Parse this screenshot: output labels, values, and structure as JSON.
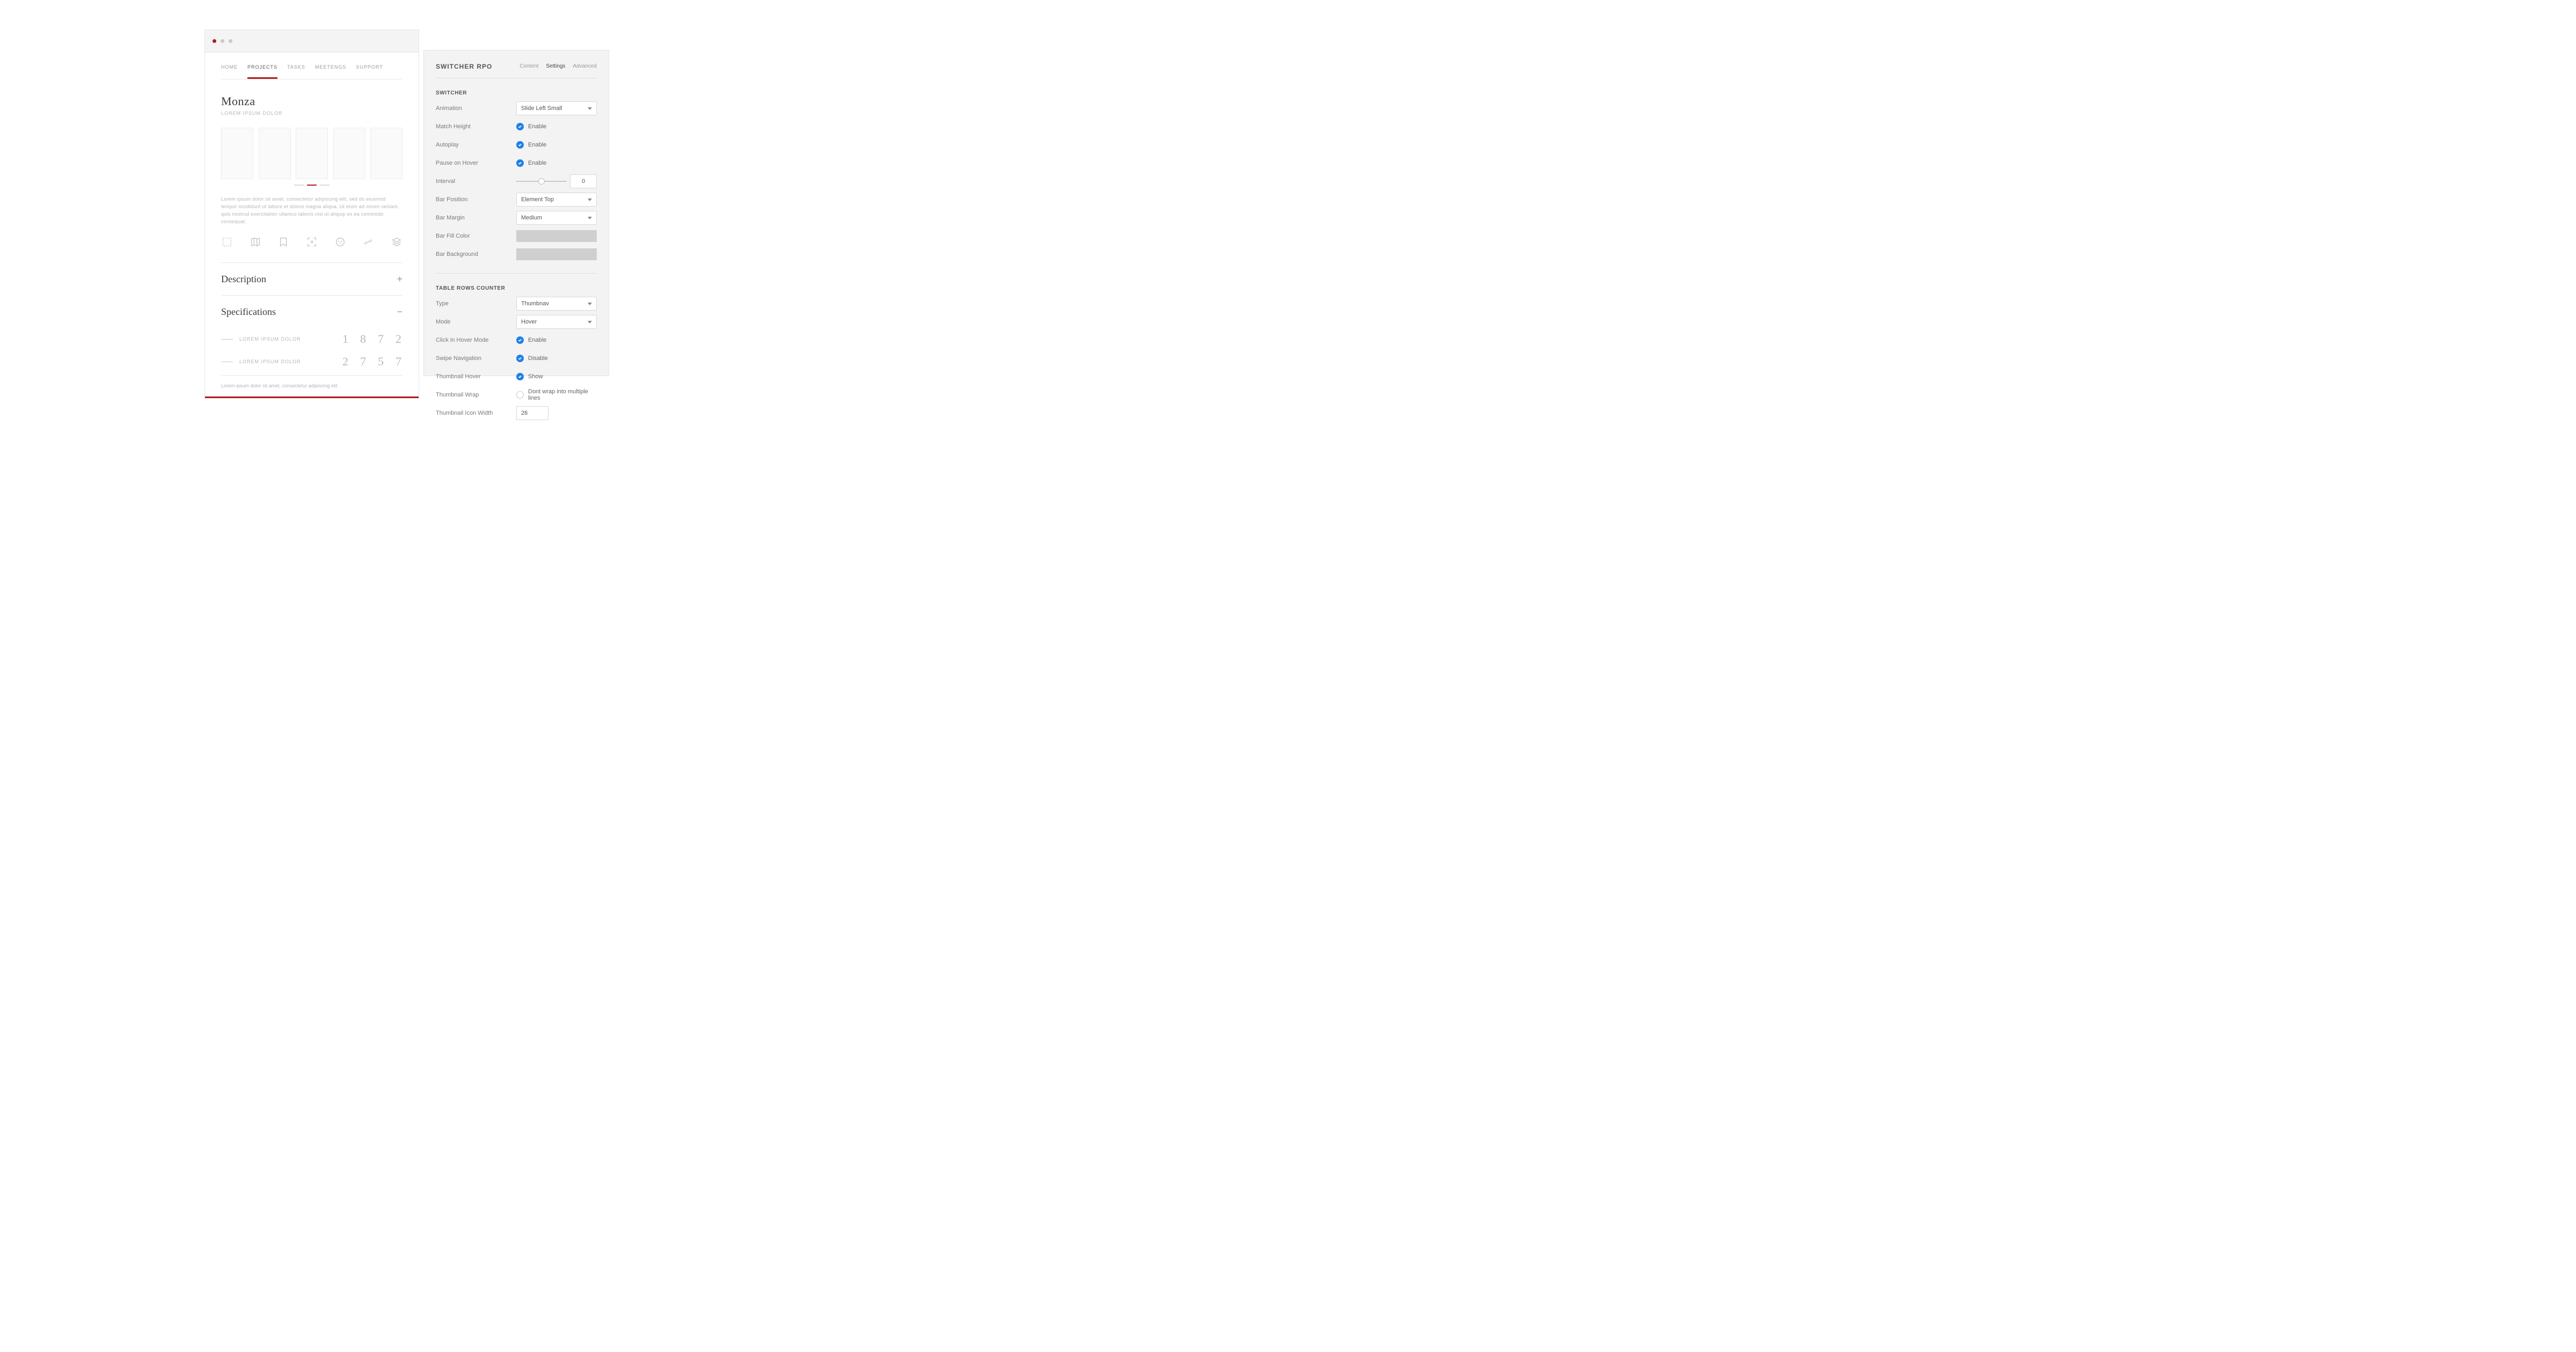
{
  "main": {
    "nav": [
      "HOME",
      "PROJECTS",
      "TASKS",
      "MEETENGS",
      "SUPPORT"
    ],
    "nav_active_index": 1,
    "title": "Monza",
    "subtitle": "LOREM IPSUM DOLOR",
    "paragraph": "Lorem ipsum dolor sit amet, consectetur adipiscing elit, sed do eiusmod tempor incididunt ut labore et dolore magna aliqua. Ut enim ad minim veniam, quis nostrud exercitation ullamco laboris nisi ut aliquip ex ea commodo consequat.",
    "accordion": {
      "description_label": "Description",
      "description_icon": "+",
      "specifications_label": "Specifications",
      "specifications_icon": "−"
    },
    "specs": [
      {
        "label": "LOREM IPSUM DOLOR",
        "digits": [
          "1",
          "8",
          "7",
          "2"
        ]
      },
      {
        "label": "LOREM IPSUM DOLOR",
        "digits": [
          "2",
          "7",
          "5",
          "7"
        ]
      }
    ],
    "footnote": "Lorem ipsum dolor sit amet, consectetur adipiscing elit"
  },
  "panel": {
    "title": "SWITCHER RPO",
    "tabs": [
      "Content",
      "Settings",
      "Advanced"
    ],
    "tabs_active_index": 1,
    "switcher_section": "SWITCHER",
    "rows": {
      "animation": {
        "label": "Animation",
        "value": "Slide Left Small"
      },
      "match_height": {
        "label": "Match Height",
        "checked": true,
        "text": "Enable"
      },
      "autoplay": {
        "label": "Autoplay",
        "checked": true,
        "text": "Enable"
      },
      "pause_hover": {
        "label": "Pause on Hover",
        "checked": true,
        "text": "Enable"
      },
      "interval": {
        "label": "Interval",
        "value": "0"
      },
      "bar_position": {
        "label": "Bar Position",
        "value": "Element Top"
      },
      "bar_margin": {
        "label": "Bar Margin",
        "value": "Medium"
      },
      "bar_fill": {
        "label": "Bar Fill Color"
      },
      "bar_bg": {
        "label": "Bar Background"
      }
    },
    "counter_section": "TABLE ROWS COUNTER",
    "rows2": {
      "type": {
        "label": "Type",
        "value": "Thumbnav"
      },
      "mode": {
        "label": "Mode",
        "value": "Hover"
      },
      "click_hover": {
        "label": "Click in Hover Mode",
        "checked": true,
        "text": "Enable"
      },
      "swipe": {
        "label": "Swipe Navigation",
        "checked": true,
        "text": "Disable"
      },
      "thumb_hover": {
        "label": "Thumbnail Hover",
        "checked": true,
        "text": "Show"
      },
      "thumb_wrap": {
        "label": "Thumbnail Wrap",
        "checked": false,
        "text": "Dont wrap into multiple lines"
      },
      "thumb_width": {
        "label": "Thumbnail Icon Width",
        "value": "26"
      }
    }
  }
}
